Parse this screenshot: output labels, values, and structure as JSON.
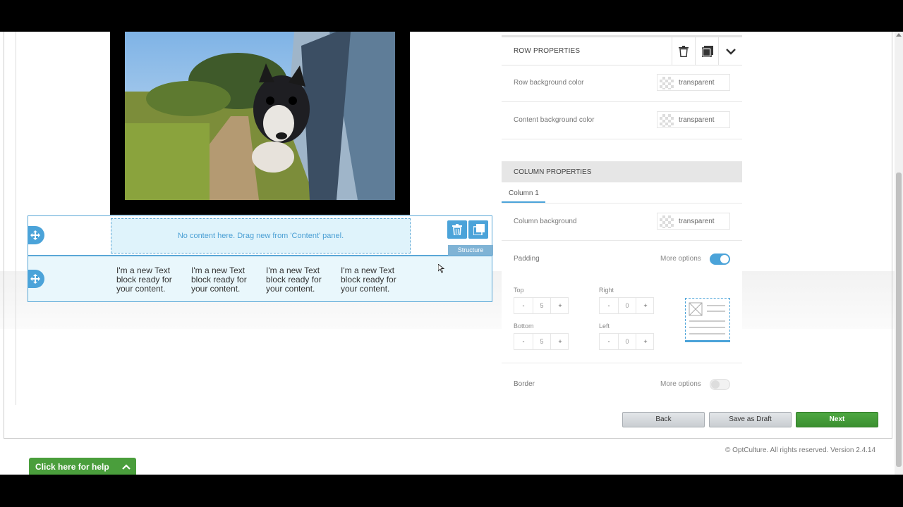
{
  "editor": {
    "empty_row_text": "No content here. Drag new from 'Content' panel.",
    "structure_label": "Structure",
    "text_blocks": [
      "I'm a new Text block ready for your content.",
      "I'm a new Text block ready for your content.",
      "I'm a new Text block ready for your content.",
      "I'm a new Text block ready for your content."
    ]
  },
  "row_properties": {
    "title": "ROW PROPERTIES",
    "row_background_label": "Row background color",
    "row_background_value": "transparent",
    "content_background_label": "Content background color",
    "content_background_value": "transparent"
  },
  "column_properties": {
    "title": "COLUMN PROPERTIES",
    "tab_label": "Column 1",
    "column_background_label": "Column background",
    "column_background_value": "transparent",
    "padding_label": "Padding",
    "padding_more_options_label": "More options",
    "padding_more_options_on": true,
    "top_label": "Top",
    "top_value": "5",
    "right_label": "Right",
    "right_value": "0",
    "bottom_label": "Bottom",
    "bottom_value": "5",
    "left_label": "Left",
    "left_value": "0",
    "minus": "-",
    "plus": "+",
    "border_label": "Border",
    "border_more_options_label": "More options",
    "border_more_options_on": false
  },
  "footer": {
    "back_label": "Back",
    "draft_label": "Save as Draft",
    "next_label": "Next",
    "copyright": "© OptCulture. All rights reserved. Version 2.4.14",
    "help_label": "Click here for help"
  },
  "colors": {
    "accent": "#4ba3d9",
    "next_green": "#4ea842",
    "help_green": "#4a9e3c"
  }
}
